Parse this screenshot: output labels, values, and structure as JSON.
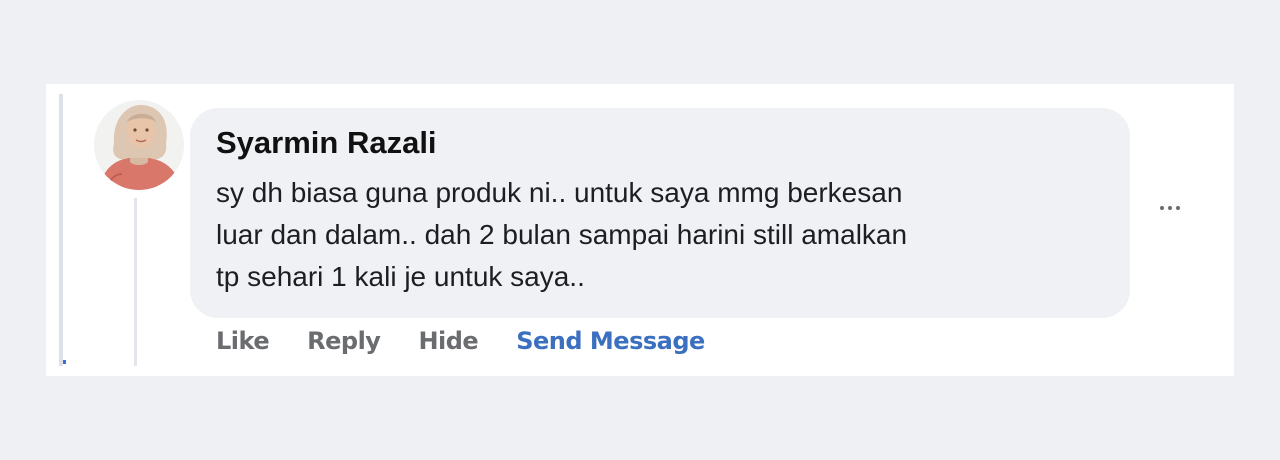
{
  "comment": {
    "author": "Syarmin Razali",
    "lines": [
      "sy dh biasa guna produk ni.. untuk saya mmg berkesan",
      "luar dan dalam.. dah 2 bulan sampai harini still amalkan",
      "tp sehari 1 kali je untuk saya.."
    ]
  },
  "actions": {
    "like": "Like",
    "reply": "Reply",
    "hide": "Hide",
    "send_message": "Send Message"
  },
  "icons": {
    "avatar": "profile-photo-woman-hijab",
    "more": "more-options-icon"
  },
  "colors": {
    "bubble": "#eff1f4",
    "action_text": "#6a6c70",
    "link_blue": "#3b6fbf",
    "page_background": "#eff0f4"
  }
}
